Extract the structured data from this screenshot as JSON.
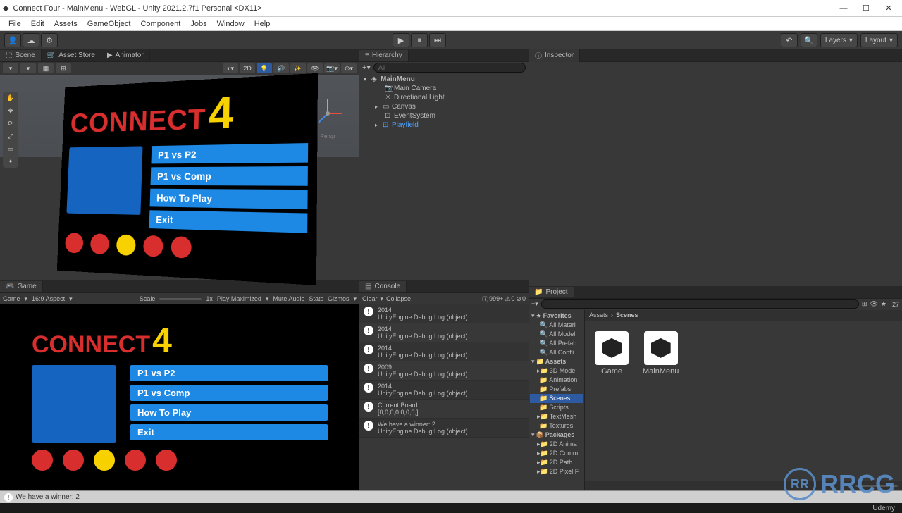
{
  "window": {
    "title": "Connect Four - MainMenu - WebGL - Unity 2021.2.7f1 Personal <DX11>"
  },
  "menubar": [
    "File",
    "Edit",
    "Assets",
    "GameObject",
    "Component",
    "Jobs",
    "Window",
    "Help"
  ],
  "toolbar": {
    "layers": "Layers",
    "layout": "Layout"
  },
  "tabs": {
    "scene": "Scene",
    "asset_store": "Asset Store",
    "animator": "Animator",
    "game": "Game",
    "console": "Console",
    "project": "Project",
    "hierarchy": "Hierarchy",
    "inspector": "Inspector"
  },
  "scene_toolbar": {
    "two_d": "2D",
    "persp": "Persp"
  },
  "scene_board": {
    "title_connect": "CONNECT",
    "title_four": "4",
    "buttons": [
      "P1 vs P2",
      "P1 vs Comp",
      "How To Play",
      "Exit"
    ]
  },
  "hierarchy": {
    "search_placeholder": "All",
    "scene_name": "MainMenu",
    "items": [
      "Main Camera",
      "Directional Light",
      "Canvas",
      "EventSystem",
      "Playfield"
    ]
  },
  "game_toolbar": {
    "display": "Game",
    "aspect": "16:9 Aspect",
    "scale": "Scale",
    "scale_val": "1x",
    "play_maximized": "Play Maximized",
    "mute": "Mute Audio",
    "stats": "Stats",
    "gizmos": "Gizmos"
  },
  "game_board": {
    "title_connect": "CONNECT",
    "title_four": "4",
    "buttons": [
      "P1 vs P2",
      "P1 vs Comp",
      "How To Play",
      "Exit"
    ]
  },
  "console_toolbar": {
    "clear": "Clear",
    "collapse": "Collapse",
    "count": "999+",
    "warn": "0",
    "err": "0"
  },
  "console_entries": [
    {
      "title": "2014",
      "detail": "UnityEngine.Debug:Log (object)"
    },
    {
      "title": "2014",
      "detail": "UnityEngine.Debug:Log (object)"
    },
    {
      "title": "2014",
      "detail": "UnityEngine.Debug:Log (object)"
    },
    {
      "title": "2009",
      "detail": "UnityEngine.Debug:Log (object)"
    },
    {
      "title": "2014",
      "detail": "UnityEngine.Debug:Log (object)"
    },
    {
      "title": "Current Board",
      "detail": "[0,0,0,0,0,0,0,]"
    },
    {
      "title": "We have a winner: 2",
      "detail": "UnityEngine.Debug:Log (object)"
    }
  ],
  "project": {
    "favorites": "Favorites",
    "fav_items": [
      "All Materi",
      "All Model",
      "All Prefab",
      "All Confli"
    ],
    "assets": "Assets",
    "asset_items": [
      "3D Mode",
      "Animation",
      "Prefabs",
      "Scenes",
      "Scripts",
      "TextMesh",
      "Textures"
    ],
    "packages": "Packages",
    "pkg_items": [
      "2D Anima",
      "2D Comm",
      "2D Path",
      "2D Pixel F"
    ],
    "breadcrumb": [
      "Assets",
      "Scenes"
    ],
    "items": [
      "Game",
      "MainMenu"
    ],
    "slider_val": "27"
  },
  "statusbar": {
    "msg": "We have a winner: 2"
  },
  "brandbar": {
    "text": "Udemy"
  },
  "watermark": {
    "code": "RR",
    "text": "RRCG"
  }
}
